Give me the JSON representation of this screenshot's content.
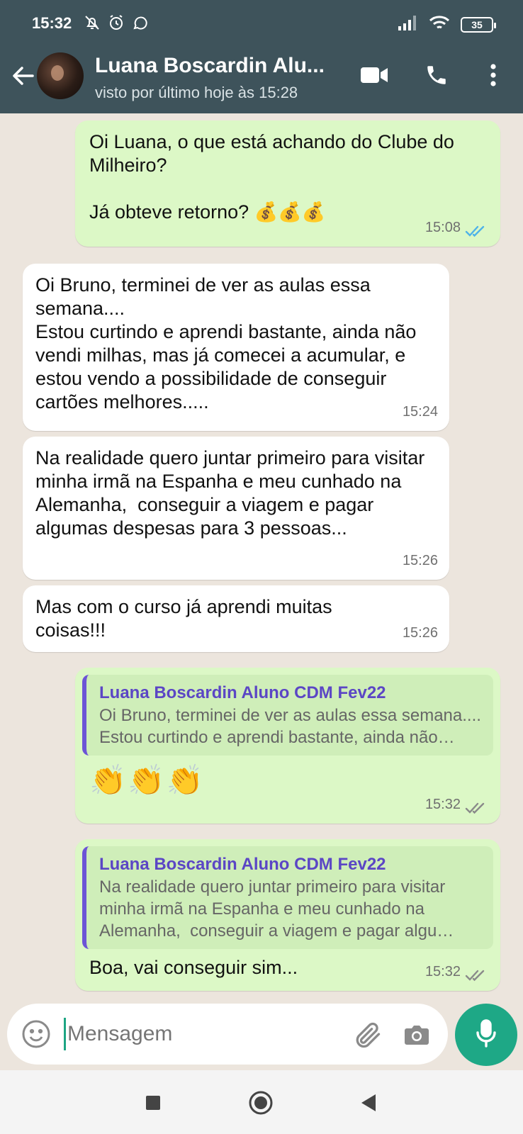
{
  "status_bar": {
    "time": "15:32",
    "battery": "35",
    "icons": [
      "bell-off-icon",
      "alarm-icon",
      "whatsapp-icon",
      "signal-icon",
      "wifi-icon",
      "battery-icon"
    ]
  },
  "header": {
    "contact_name": "Luana Boscardin Alu...",
    "last_seen": "visto por último hoje às 15:28"
  },
  "messages": [
    {
      "dir": "out",
      "text": "Oi Luana, o que está achando do Clube do Milheiro?\n\nJá obteve retorno? 💰💰💰",
      "time": "15:08",
      "status": "read"
    },
    {
      "dir": "in",
      "text": "Oi Bruno, terminei de ver as aulas essa semana....\nEstou curtindo e aprendi bastante, ainda não vendi milhas, mas já comecei a acumular, e estou vendo a possibilidade de conseguir cartões melhores.....",
      "time": "15:24"
    },
    {
      "dir": "in",
      "text": "Na realidade quero juntar primeiro para visitar minha irmã na Espanha e meu cunhado na Alemanha,  conseguir a viagem e pagar algumas despesas para 3 pessoas...",
      "time": "15:26"
    },
    {
      "dir": "in",
      "text": "Mas com o curso já aprendi muitas coisas!!!",
      "time": "15:26"
    },
    {
      "dir": "out",
      "quote_name": "Luana Boscardin Aluno CDM Fev22",
      "quote_text": "Oi Bruno, terminei de ver as aulas essa semana....\nEstou curtindo e aprendi bastante, ainda não…",
      "text": "👏👏👏",
      "time": "15:32",
      "status": "delivered"
    },
    {
      "dir": "out",
      "quote_name": "Luana Boscardin Aluno CDM Fev22",
      "quote_text": "Na realidade quero juntar primeiro para visitar minha irmã na Espanha e meu cunhado na Alemanha,  conseguir a viagem e pagar algu…",
      "text": "Boa, vai conseguir sim...",
      "time": "15:32",
      "status": "delivered"
    }
  ],
  "composer": {
    "placeholder": "Mensagem"
  },
  "colors": {
    "header": "#3e535b",
    "outgoing_bubble": "#dcf8c6",
    "incoming_bubble": "#ffffff",
    "chat_background": "#ece5dd",
    "accent": "#1ea886",
    "read_ticks": "#4fb3e8",
    "quote_name": "#5b46c5"
  }
}
